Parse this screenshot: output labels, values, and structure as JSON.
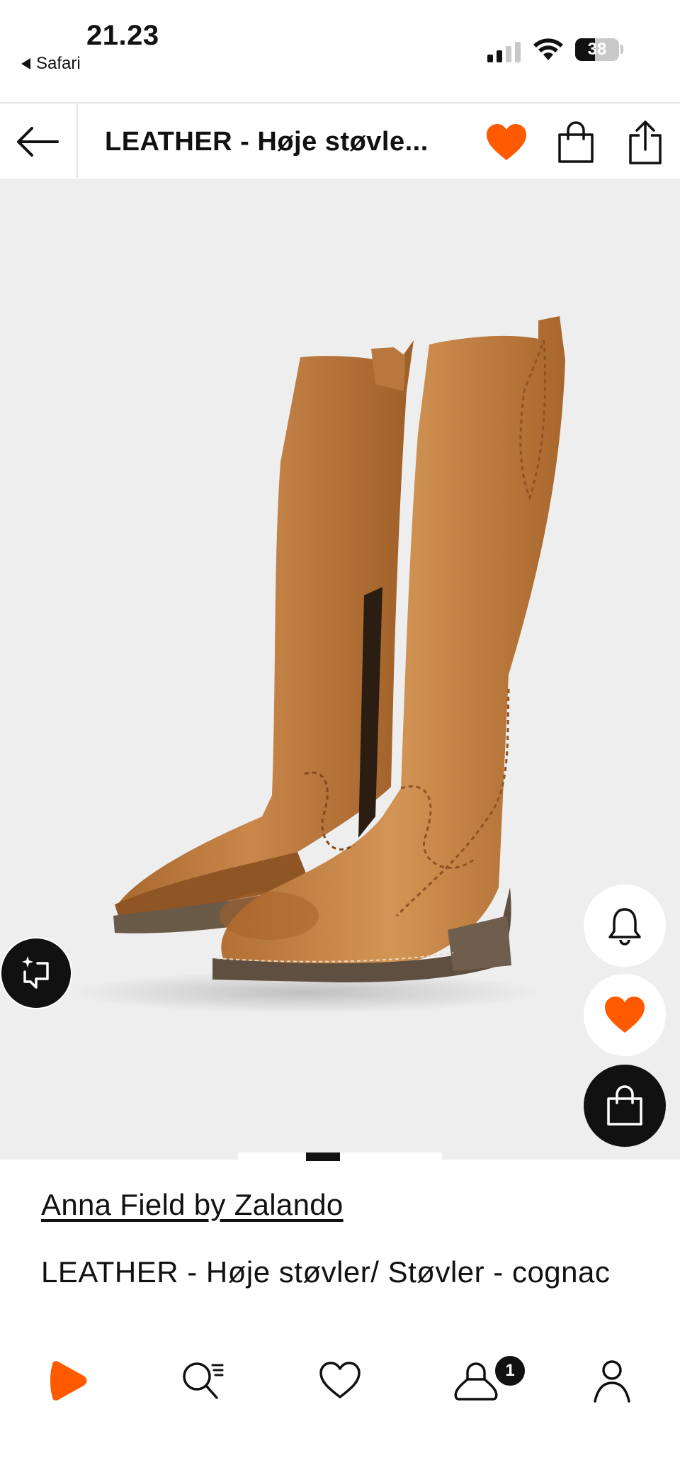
{
  "status_bar": {
    "time": "21.23",
    "back_app": "Safari",
    "battery": "38"
  },
  "nav": {
    "title": "LEATHER  - Høje støvle..."
  },
  "product": {
    "brand": "Anna Field by Zalando",
    "name": "LEATHER  - Høje støvler/ Støvler - cognac",
    "image_page": 2,
    "image_count": 6
  },
  "tab_bar": {
    "cart_count": "1"
  },
  "colors": {
    "accent": "#ff5a00",
    "dark": "#111111",
    "image_bg": "#eeeeee"
  },
  "icons": [
    "back-arrow-icon",
    "heart-filled-icon",
    "shopping-bag-icon",
    "share-icon",
    "bell-icon",
    "sparkle-crop-icon",
    "zalando-logo-icon",
    "search-list-icon",
    "heart-outline-icon",
    "bag-person-icon",
    "profile-icon"
  ]
}
